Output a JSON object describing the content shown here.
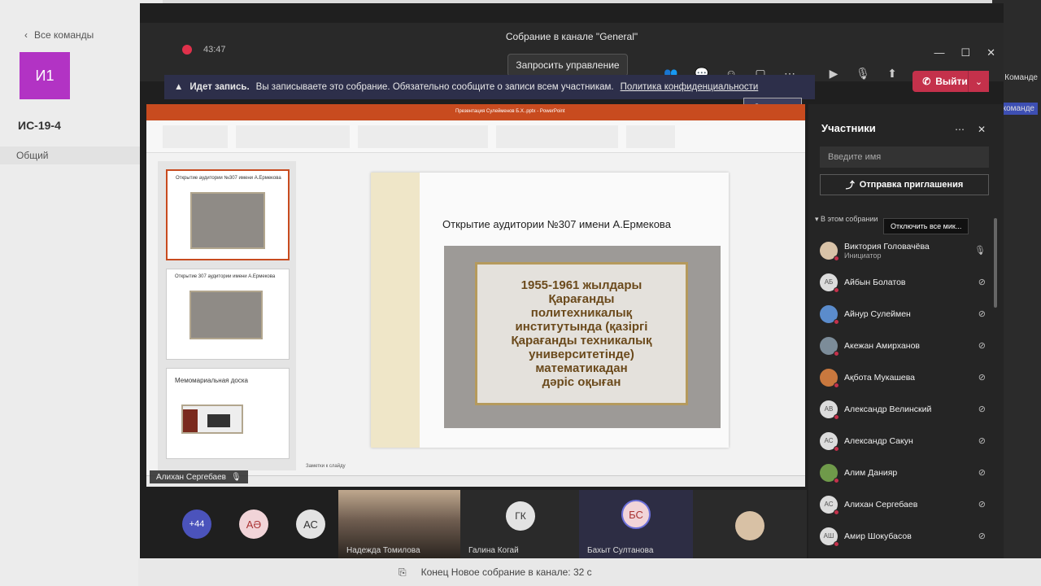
{
  "background": {
    "back_link": "Все команды",
    "team_avatar": "И1",
    "team_name": "ИС-19-4",
    "channel": "Общий",
    "right_hint_1": "Команде",
    "right_hint_2": "в команде"
  },
  "meeting": {
    "window_title": "Собрание в канале \"General\"",
    "timer": "43:47",
    "request_control": "Запросить управление",
    "leave_label": "Выйти",
    "recording_bold": "Идет запись.",
    "recording_text": "Вы записываете это собрание. Обязательно сообщите о записи всем участникам.",
    "privacy_link": "Политика конфиденциальности",
    "close_label": "Закрыть"
  },
  "presentation": {
    "doc_title": "Презентация Сулейменов Б.Х..pptx - PowerPoint",
    "slide_title": "Открытие аудитории №307 имени А.Ермекова",
    "plaque_lines": [
      "1955-1961 жылдары",
      "Қарағанды",
      "политехникалық",
      "институтында (қазіргі",
      "Қарағанды техникалық",
      "университетінде)",
      "математикадан",
      "дәріс оқыған"
    ],
    "thumb1_caption": "Открытие аудитории №307 имени А.Ермекова",
    "thumb2_caption": "Открытие 307 аудитории имени А.Ермекова",
    "thumb3_caption": "Мемомариальная доска",
    "notes_placeholder": "Заметки к слайду",
    "presenter_name": "Алихан Сергебаев"
  },
  "strip": {
    "more_count": "+44",
    "avatar1": "АӘ",
    "avatar2": "АС",
    "tile_nadezhda": "Надежда Томилова",
    "tile_galina": "Галина Когай",
    "galina_initials": "ГК",
    "tile_bakhyt": "Бахыт Султанова",
    "bakhyt_initials": "БС"
  },
  "panel": {
    "title": "Участники",
    "search_placeholder": "Введите имя",
    "invite_label": "Отправка приглашения",
    "section_label": "В этом собрании",
    "mute_all_tooltip": "Отключить все мик...",
    "participants": [
      {
        "name": "Виктория Головачёва",
        "sub": "Инициатор",
        "initials": "",
        "color": "#d9c3a8"
      },
      {
        "name": "Айбын Болатов",
        "sub": "",
        "initials": "АБ",
        "color": "#dcdcdc"
      },
      {
        "name": "Айнур Сулеймен",
        "sub": "",
        "initials": "",
        "color": "#5b8ccc"
      },
      {
        "name": "Акежан Амирханов",
        "sub": "",
        "initials": "",
        "color": "#7c8c99"
      },
      {
        "name": "Ақбота Мукашева",
        "sub": "",
        "initials": "",
        "color": "#c9783e"
      },
      {
        "name": "Александр Велинский",
        "sub": "",
        "initials": "АВ",
        "color": "#dcdcdc"
      },
      {
        "name": "Александр Сакун",
        "sub": "",
        "initials": "АС",
        "color": "#dcdcdc"
      },
      {
        "name": "Алим Данияр",
        "sub": "",
        "initials": "",
        "color": "#6f9a4a"
      },
      {
        "name": "Алихан Сергебаев",
        "sub": "",
        "initials": "АС",
        "color": "#dcdcdc"
      },
      {
        "name": "Амир Шокубасов",
        "sub": "",
        "initials": "АШ",
        "color": "#dcdcdc"
      }
    ]
  },
  "bottom_bar": {
    "text": "Конец Новое собрание в канале: 32 с"
  }
}
